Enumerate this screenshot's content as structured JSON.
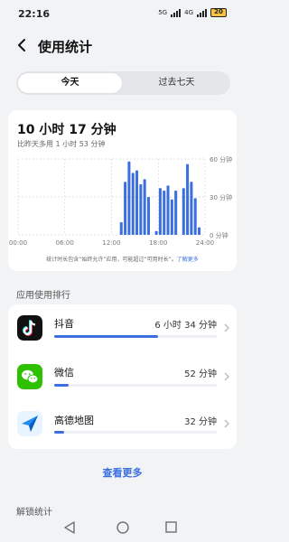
{
  "status_bar": {
    "time": "22:16",
    "net_5g": "5G",
    "net_4g": "4G",
    "battery": "20"
  },
  "header": {
    "title": "使用统计"
  },
  "tabs": [
    {
      "label": "今天",
      "active": true
    },
    {
      "label": "过去七天",
      "active": false
    }
  ],
  "summary": {
    "total": "10 小时 17 分钟",
    "compare": "比昨天多用 1 小时 53 分钟"
  },
  "chart_data": {
    "type": "bar",
    "x_tick_labels": [
      "00:00",
      "06:00",
      "12:00",
      "18:00",
      "24:00"
    ],
    "y_tick_labels": [
      "60 分钟",
      "30 分钟",
      "0 分钟"
    ],
    "ylim": [
      0,
      60
    ],
    "grid": true,
    "x": [
      "06:00",
      "06:30",
      "07:00",
      "07:30",
      "08:00",
      "08:30",
      "09:00",
      "09:30",
      "10:00",
      "10:30",
      "11:00",
      "11:30",
      "12:00",
      "12:30",
      "13:00",
      "13:30",
      "14:00",
      "14:30",
      "15:00",
      "15:30",
      "16:00",
      "16:30",
      "17:00",
      "17:30",
      "18:00",
      "18:30",
      "19:00",
      "19:30",
      "20:00",
      "20:30",
      "21:00",
      "21:30",
      "22:00",
      "22:30",
      "23:00",
      "23:30"
    ],
    "values": [
      0,
      0,
      0,
      0,
      0,
      0,
      0,
      0,
      0,
      0,
      0,
      0,
      0,
      0,
      10,
      42,
      58,
      49,
      51,
      40,
      44,
      30,
      0,
      3,
      37,
      35,
      39,
      28,
      35,
      0,
      37,
      56,
      42,
      29,
      6,
      0
    ],
    "note": "统计时长包含“始终允许”应用，可能超过“可用时长”。",
    "note_link": "了解更多"
  },
  "ranking": {
    "title": "应用使用排行",
    "apps": [
      {
        "name": "抖音",
        "time": "6 小时 34 分钟",
        "fraction": 0.64,
        "icon": "douyin-icon"
      },
      {
        "name": "微信",
        "time": "52 分钟",
        "fraction": 0.09,
        "icon": "wechat-icon"
      },
      {
        "name": "高德地图",
        "time": "32 分钟",
        "fraction": 0.06,
        "icon": "amap-icon"
      }
    ],
    "more": "查看更多"
  },
  "unlock": {
    "title": "解锁统计"
  },
  "colors": {
    "accent": "#3b6fe0",
    "background": "#f1f3f5"
  }
}
